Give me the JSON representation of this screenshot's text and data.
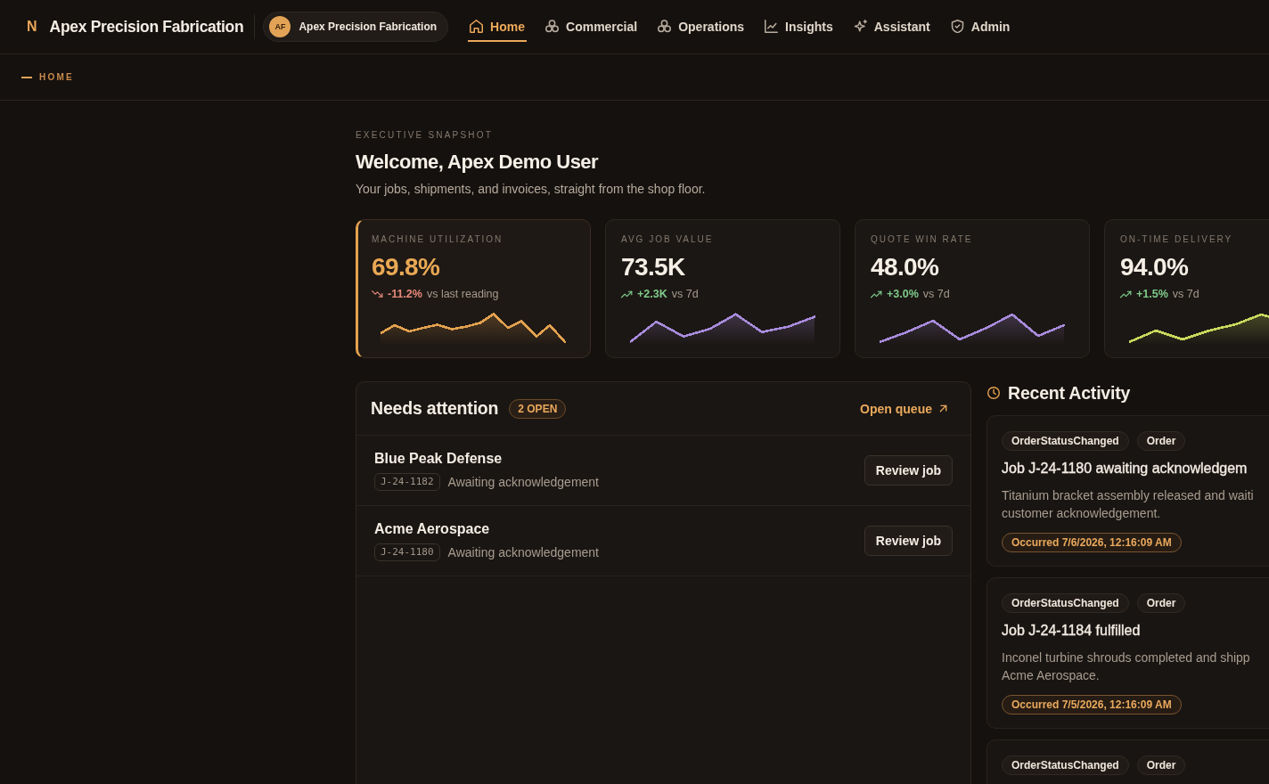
{
  "header": {
    "logo_mark": "N",
    "brand": "Apex Precision Fabrication",
    "workspace": {
      "initials": "AF",
      "name": "Apex Precision Fabrication"
    },
    "nav": [
      {
        "label": "Home",
        "selected": true
      },
      {
        "label": "Commercial",
        "selected": false
      },
      {
        "label": "Operations",
        "selected": false
      },
      {
        "label": "Insights",
        "selected": false
      },
      {
        "label": "Assistant",
        "selected": false
      },
      {
        "label": "Admin",
        "selected": false
      }
    ]
  },
  "breadcrumb": {
    "label": "HOME"
  },
  "intro": {
    "eyebrow": "EXECUTIVE SNAPSHOT",
    "title": "Welcome, Apex Demo User",
    "subtitle": "Your jobs, shipments, and invoices, straight from the shop floor."
  },
  "kpis": [
    {
      "label": "MACHINE UTILIZATION",
      "value": "69.8%",
      "delta": "-11.2%",
      "comparison": "vs last reading",
      "falling": true,
      "selected": true,
      "color": "#e3a24f"
    },
    {
      "label": "AVG JOB VALUE",
      "value": "73.5K",
      "delta": "+2.3K",
      "comparison": "vs 7d",
      "falling": false,
      "selected": false,
      "color": "#a88bdc"
    },
    {
      "label": "QUOTE WIN RATE",
      "value": "48.0%",
      "delta": "+3.0%",
      "comparison": "vs 7d",
      "falling": false,
      "selected": false,
      "color": "#a88bdc"
    },
    {
      "label": "ON-TIME DELIVERY",
      "value": "94.0%",
      "delta": "+1.5%",
      "comparison": "vs 7d",
      "falling": false,
      "selected": false,
      "color": "#c7d95c"
    }
  ],
  "attention": {
    "title": "Needs attention",
    "badge": "2 OPEN",
    "link": "Open queue",
    "items": [
      {
        "company": "Blue Peak Defense",
        "job_id": "J-24-1182",
        "status": "Awaiting acknowledgement",
        "action": "Review job"
      },
      {
        "company": "Acme Aerospace",
        "job_id": "J-24-1180",
        "status": "Awaiting acknowledgement",
        "action": "Review job"
      }
    ]
  },
  "activity": {
    "title": "Recent Activity",
    "items": [
      {
        "tags": [
          "OrderStatusChanged",
          "Order"
        ],
        "title": "Job J-24-1180 awaiting acknowledgem",
        "description": "Titanium bracket assembly released and waiti\ncustomer acknowledgement.",
        "occurred": "Occurred 7/6/2026, 12:16:09 AM"
      },
      {
        "tags": [
          "OrderStatusChanged",
          "Order"
        ],
        "title": "Job J-24-1184 fulfilled",
        "description": "Inconel turbine shrouds completed and shipp\nAcme Aerospace.",
        "occurred": "Occurred 7/5/2026, 12:16:09 AM"
      },
      {
        "tags": [
          "OrderStatusChanged",
          "Order"
        ]
      }
    ]
  }
}
